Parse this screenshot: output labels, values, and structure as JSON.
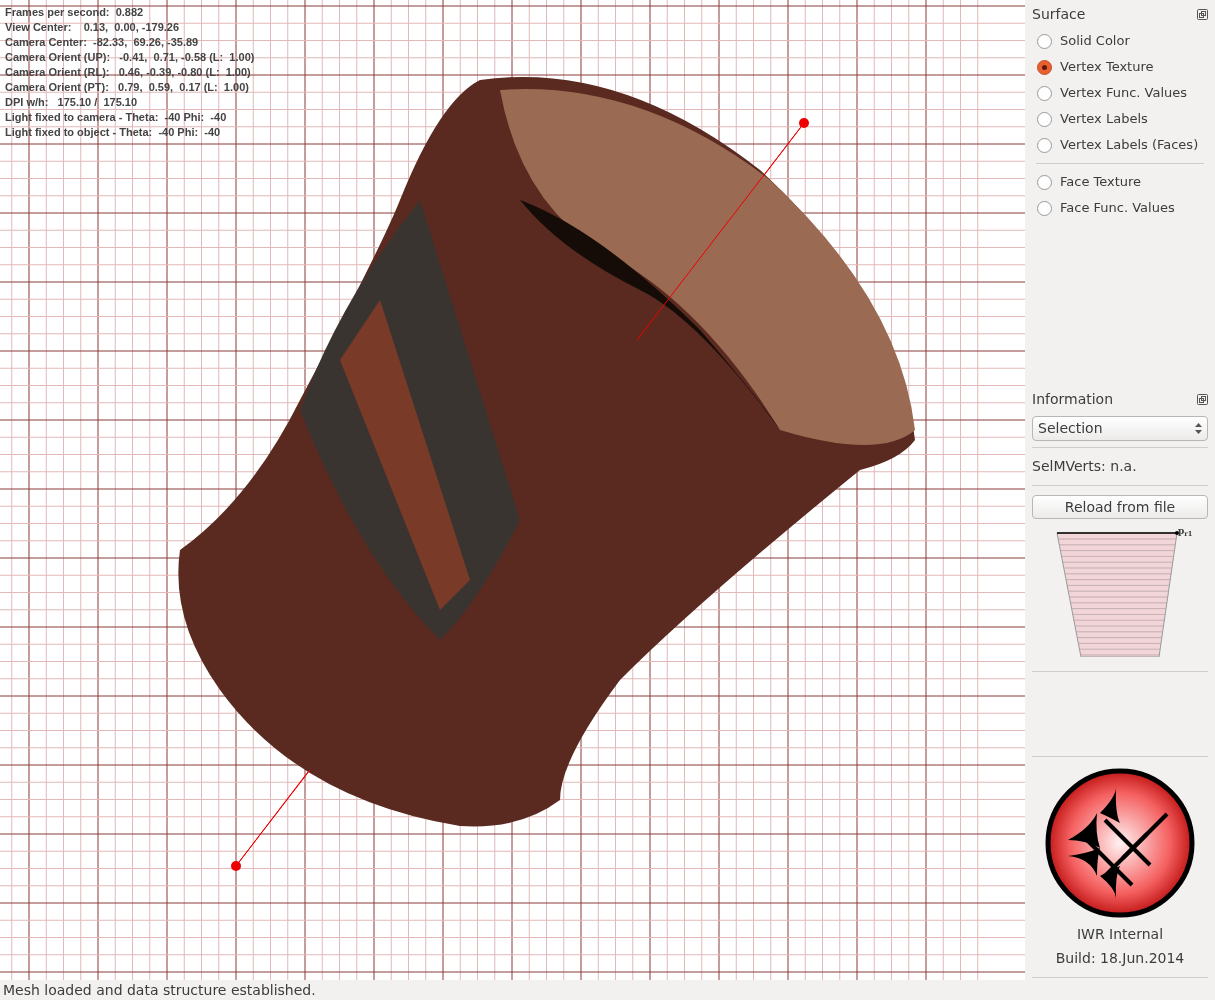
{
  "viewport": {
    "overlay_lines": [
      "Frames per second:  0.882",
      "View Center:    0.13,  0.00, -179.26",
      "Camera Center:  -82.33,  69.26, -35.89",
      "Camera Orient (UP):   -0.41,  0.71, -0.58 (L:  1.00)",
      "Camera Orient (RL):   0.46, -0.39, -0.80 (L:  1.00)",
      "Camera Orient (PT):   0.79,  0.59,  0.17 (L:  1.00)",
      "DPI w/h:   175.10 /  175.10",
      "Light fixed to camera - Theta:  -40 Phi:  -40",
      "Light fixed to object - Theta:  -40 Phi:  -40"
    ]
  },
  "surface": {
    "title": "Surface",
    "options": [
      {
        "label": "Solid Color",
        "selected": false
      },
      {
        "label": "Vertex Texture",
        "selected": true
      },
      {
        "label": "Vertex Func. Values",
        "selected": false
      },
      {
        "label": "Vertex Labels",
        "selected": false
      },
      {
        "label": "Vertex Labels (Faces)",
        "selected": false
      }
    ],
    "face_options": [
      {
        "label": "Face Texture",
        "selected": false
      },
      {
        "label": "Face Func. Values",
        "selected": false
      }
    ]
  },
  "information": {
    "title": "Information",
    "dropdown": "Selection",
    "sel_mverts": "SelMVerts: n.a.",
    "reload_button": "Reload from file",
    "profile_label": "p$_{r1}$"
  },
  "about": {
    "name": "IWR Internal",
    "build": "Build: 18.Jun.2014"
  },
  "status_bar": "Mesh loaded and data structure established."
}
